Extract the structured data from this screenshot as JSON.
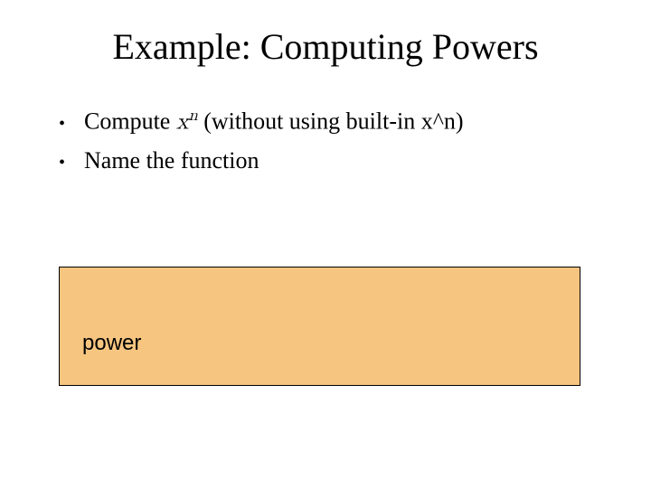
{
  "slide": {
    "title": "Example: Computing Powers",
    "bullets": [
      {
        "prefix": "Compute ",
        "math_base": "x",
        "math_exp": "n",
        "suffix": " (without using built-in x^n)"
      },
      {
        "text": "Name the function"
      }
    ],
    "answer_box": {
      "content": "power"
    }
  }
}
